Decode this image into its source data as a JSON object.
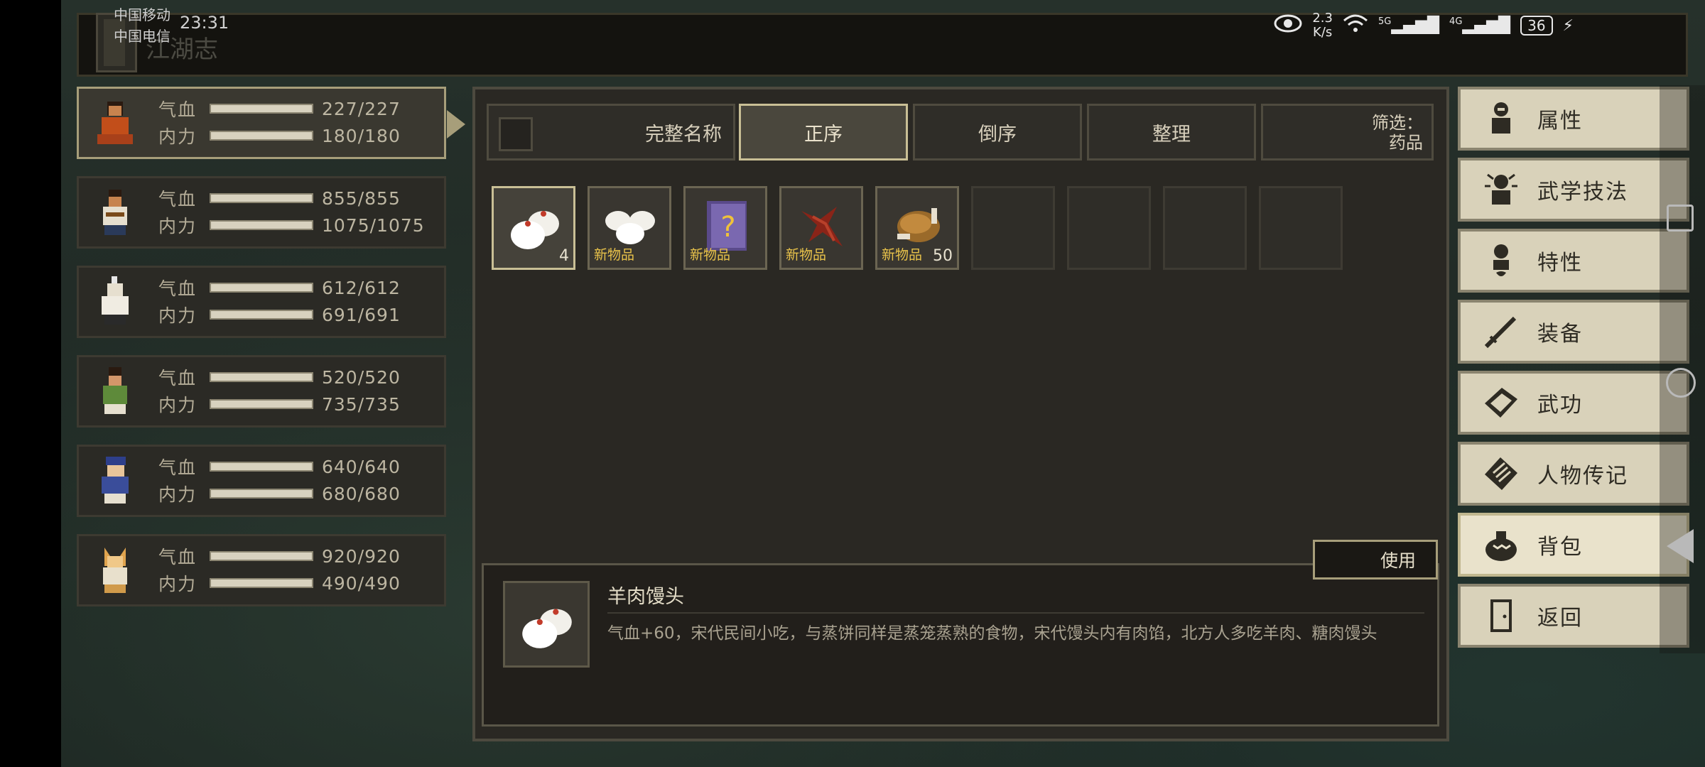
{
  "status_bar": {
    "carrier1": "中国移动",
    "carrier2": "中国电信",
    "time": "23:31",
    "speed_value": "2.3",
    "speed_unit": "K/s",
    "signal1": "5G",
    "signal2": "4G",
    "battery": "36"
  },
  "header": {
    "title": "江湖志"
  },
  "characters": [
    {
      "hp_label": "气血",
      "hp": "227/227",
      "mp_label": "内力",
      "mp": "180/180"
    },
    {
      "hp_label": "气血",
      "hp": "855/855",
      "mp_label": "内力",
      "mp": "1075/1075"
    },
    {
      "hp_label": "气血",
      "hp": "612/612",
      "mp_label": "内力",
      "mp": "691/691"
    },
    {
      "hp_label": "气血",
      "hp": "520/520",
      "mp_label": "内力",
      "mp": "735/735"
    },
    {
      "hp_label": "气血",
      "hp": "640/640",
      "mp_label": "内力",
      "mp": "680/680"
    },
    {
      "hp_label": "气血",
      "hp": "920/920",
      "mp_label": "内力",
      "mp": "490/490"
    }
  ],
  "sort_bar": {
    "full_name": "完整名称",
    "ascending": "正序",
    "descending": "倒序",
    "organize": "整理",
    "filter_label": "筛选：",
    "filter_value": "药品"
  },
  "items": [
    {
      "icon": "steamed-bun-icon",
      "new_label": "",
      "count": "4"
    },
    {
      "icon": "steamed-buns-icon",
      "new_label": "新物品",
      "count": ""
    },
    {
      "icon": "mystery-book-icon",
      "new_label": "新物品",
      "count": ""
    },
    {
      "icon": "red-herb-icon",
      "new_label": "新物品",
      "count": ""
    },
    {
      "icon": "roast-chicken-icon",
      "new_label": "新物品",
      "count": "50"
    }
  ],
  "detail": {
    "use_button": "使用",
    "name": "羊肉馒头",
    "description": "气血+60，宋代民间小吃，与蒸饼同样是蒸笼蒸熟的食物，宋代馒头内有肉馅，北方人多吃羊肉、糖肉馒头"
  },
  "menu": [
    {
      "label": "属性",
      "icon": "attribute-icon"
    },
    {
      "label": "武学技法",
      "icon": "martial-skill-icon"
    },
    {
      "label": "特性",
      "icon": "trait-icon"
    },
    {
      "label": "装备",
      "icon": "equipment-icon"
    },
    {
      "label": "武功",
      "icon": "martial-book-icon"
    },
    {
      "label": "人物传记",
      "icon": "biography-icon"
    },
    {
      "label": "背包",
      "icon": "bag-icon"
    },
    {
      "label": "返回",
      "icon": "exit-door-icon"
    }
  ]
}
